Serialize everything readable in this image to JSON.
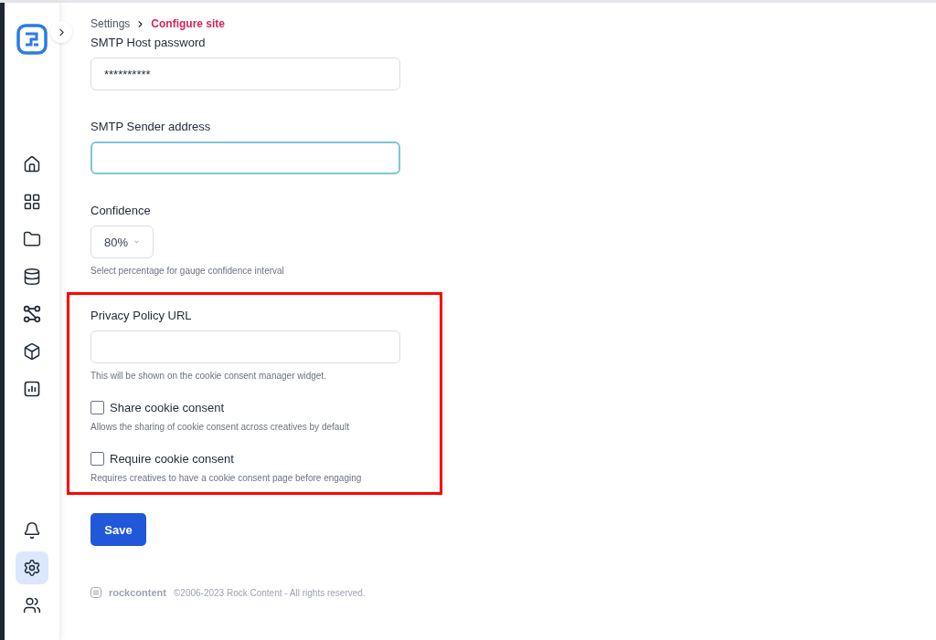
{
  "sidebar": {
    "items": [
      {
        "kind": "home",
        "selected": false
      },
      {
        "kind": "grid",
        "selected": false
      },
      {
        "kind": "folder",
        "selected": false
      },
      {
        "kind": "database",
        "selected": false
      },
      {
        "kind": "nodes",
        "selected": false
      },
      {
        "kind": "box",
        "selected": false
      },
      {
        "kind": "chart",
        "selected": false
      }
    ],
    "bottom_items": [
      {
        "kind": "bell",
        "selected": false
      },
      {
        "kind": "settings",
        "selected": true
      },
      {
        "kind": "users",
        "selected": false
      }
    ]
  },
  "breadcrumb": [
    {
      "label": "Settings",
      "selected": false
    },
    {
      "label": "Configure site",
      "selected": true
    }
  ],
  "sections": [
    {
      "highlighted": false,
      "fields": [
        {
          "kind": "text",
          "label": "SMTP Host password",
          "value": "**********",
          "focused": false
        },
        {
          "kind": "text",
          "label": "SMTP Sender address",
          "focused": true
        },
        {
          "kind": "select",
          "label": "Confidence",
          "value": "80%",
          "help": "Select percentage for gauge confidence interval"
        }
      ]
    },
    {
      "highlighted": true,
      "fields": [
        {
          "kind": "text",
          "label": "Privacy Policy URL",
          "focused": false,
          "help": "This will be shown on the cookie consent manager widget."
        },
        {
          "kind": "checkbox",
          "label": "Share cookie consent",
          "checked": false,
          "help": "Allows the sharing of cookie consent across creatives by default"
        },
        {
          "kind": "checkbox",
          "label": "Require cookie consent",
          "checked": false,
          "help": "Requires creatives to have a cookie consent page before engaging"
        }
      ]
    }
  ],
  "save_button": "Save",
  "footer": {
    "brand": "rockcontent",
    "copyright": "©2006-2023 Rock Content - All rights reserved."
  }
}
